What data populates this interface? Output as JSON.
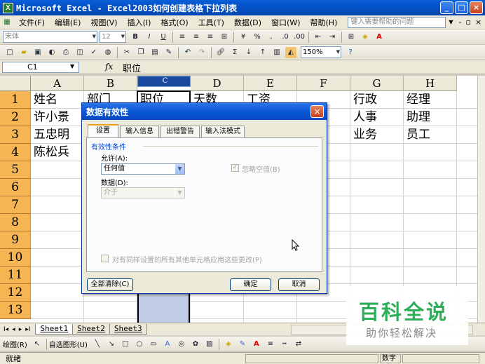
{
  "window": {
    "title": "Microsoft Excel - Excel2003如何创建表格下拉列表"
  },
  "menu": {
    "items": [
      "文件(F)",
      "编辑(E)",
      "视图(V)",
      "插入(I)",
      "格式(O)",
      "工具(T)",
      "数据(D)",
      "窗口(W)",
      "帮助(H)"
    ],
    "help_placeholder": "键入需要帮助的问题"
  },
  "format_toolbar": {
    "font": "宋体",
    "size": "12"
  },
  "std_toolbar": {
    "zoom": "150%"
  },
  "formula_bar": {
    "name_box": "C1",
    "fx": "fx",
    "value": "职位"
  },
  "columns": [
    "A",
    "B",
    "C",
    "D",
    "E",
    "F",
    "G",
    "H"
  ],
  "selected_column": "C",
  "rows": [
    "1",
    "2",
    "3",
    "4",
    "5",
    "6",
    "7",
    "8",
    "9",
    "10",
    "11",
    "12",
    "13"
  ],
  "cells": {
    "A1": "姓名",
    "B1": "部门",
    "C1": "职位",
    "D1": "天数",
    "E1": "工资",
    "A2": "许小景",
    "A3": "五忠明",
    "A4": "陈松兵",
    "G1": "行政",
    "H1": "经理",
    "G2": "人事",
    "H2": "助理",
    "G3": "业务",
    "H3": "员工"
  },
  "sheet_tabs": [
    "Sheet1",
    "Sheet2",
    "Sheet3"
  ],
  "draw_toolbar": {
    "draw": "绘图(R)",
    "autoshape": "自选图形(U)"
  },
  "status": {
    "left": "就绪",
    "num": "数字"
  },
  "dialog": {
    "title": "数据有效性",
    "tabs": [
      "设置",
      "输入信息",
      "出错警告",
      "输入法模式"
    ],
    "group_label": "有效性条件",
    "allow_label": "允许(A):",
    "allow_value": "任何值",
    "ignore_blank": "忽略空值(B)",
    "data_label": "数据(D):",
    "data_value": "介于",
    "apply_all": "对有同样设置的所有其他单元格应用这些更改(P)",
    "clear_button": "全部清除(C)",
    "ok_button": "确定",
    "cancel_button": "取消"
  },
  "watermark": {
    "title": "百科全说",
    "subtitle": "助你轻松解决"
  }
}
